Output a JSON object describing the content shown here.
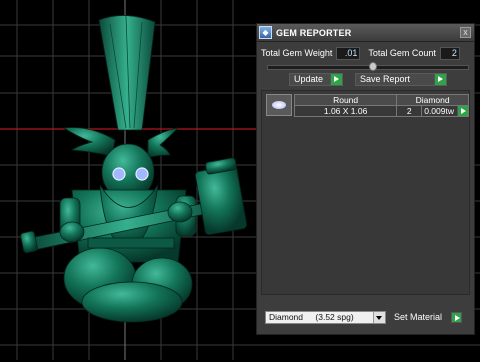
{
  "panel": {
    "title": "GEM REPORTER",
    "close_label": "x",
    "total_weight_label": "Total Gem Weight",
    "total_weight_value": ".01",
    "total_count_label": "Total Gem Count",
    "total_count_value": "2",
    "update_label": "Update",
    "save_report_label": "Save Report",
    "table": {
      "headers": [
        "Round",
        "Diamond"
      ],
      "row": {
        "size": "1.06 X 1.06",
        "count": "2",
        "weight": "0.009tw"
      }
    },
    "material_select": {
      "value": "Diamond",
      "spg": "(3.52 spg)"
    },
    "set_material_label": "Set Material"
  },
  "colors": {
    "model": "#0f6b52",
    "grid": "#3a3a3a",
    "axis": "#b4151a",
    "accent_button": "#2fa24a"
  }
}
